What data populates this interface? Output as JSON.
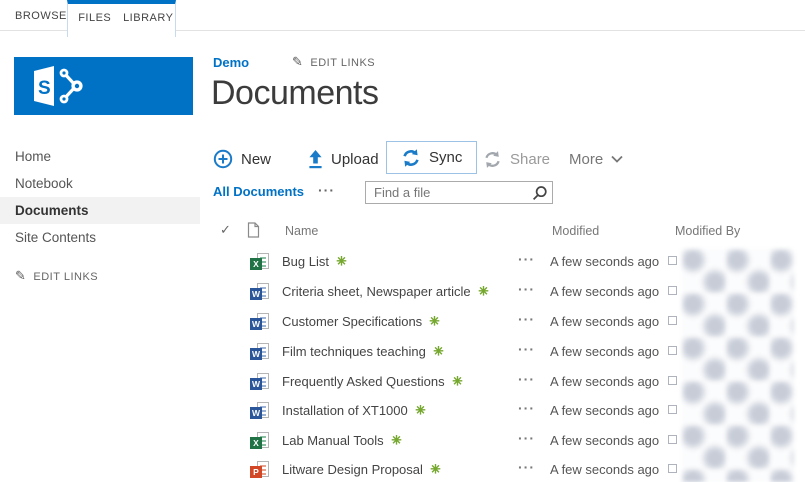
{
  "colors": {
    "accent": "#0072c6",
    "excel": "#217346",
    "word": "#2b579a",
    "powerpoint": "#d24726",
    "new_badge": "#76a72f"
  },
  "ribbon": {
    "browse": "BROWSE",
    "files": "FILES",
    "library": "LIBRARY"
  },
  "sidebar": {
    "items": [
      {
        "label": "Home",
        "selected": false
      },
      {
        "label": "Notebook",
        "selected": false
      },
      {
        "label": "Documents",
        "selected": true
      },
      {
        "label": "Site Contents",
        "selected": false
      }
    ],
    "edit_links": "EDIT LINKS"
  },
  "header": {
    "breadcrumb": "Demo",
    "edit_links": "EDIT LINKS",
    "title": "Documents"
  },
  "toolbar": {
    "new": "New",
    "upload": "Upload",
    "sync": "Sync",
    "share": "Share",
    "more": "More"
  },
  "view_bar": {
    "view": "All Documents",
    "overflow": "···",
    "search_placeholder": "Find a file"
  },
  "table": {
    "columns": {
      "name": "Name",
      "modified": "Modified",
      "modified_by": "Modified By"
    },
    "row_overflow": "···",
    "rows": [
      {
        "name": "Bug List",
        "type": "excel",
        "icon_letter": "X",
        "modified": "A few seconds ago",
        "is_new": true
      },
      {
        "name": "Criteria sheet, Newspaper article",
        "type": "word",
        "icon_letter": "W",
        "modified": "A few seconds ago",
        "is_new": true
      },
      {
        "name": "Customer Specifications",
        "type": "word",
        "icon_letter": "W",
        "modified": "A few seconds ago",
        "is_new": true
      },
      {
        "name": "Film techniques teaching",
        "type": "word",
        "icon_letter": "W",
        "modified": "A few seconds ago",
        "is_new": true
      },
      {
        "name": "Frequently Asked Questions",
        "type": "word",
        "icon_letter": "W",
        "modified": "A few seconds ago",
        "is_new": true
      },
      {
        "name": "Installation of XT1000",
        "type": "word",
        "icon_letter": "W",
        "modified": "A few seconds ago",
        "is_new": true
      },
      {
        "name": "Lab Manual Tools",
        "type": "excel",
        "icon_letter": "X",
        "modified": "A few seconds ago",
        "is_new": true
      },
      {
        "name": "Litware Design Proposal",
        "type": "powerpoint",
        "icon_letter": "P",
        "modified": "A few seconds ago",
        "is_new": true
      }
    ]
  }
}
